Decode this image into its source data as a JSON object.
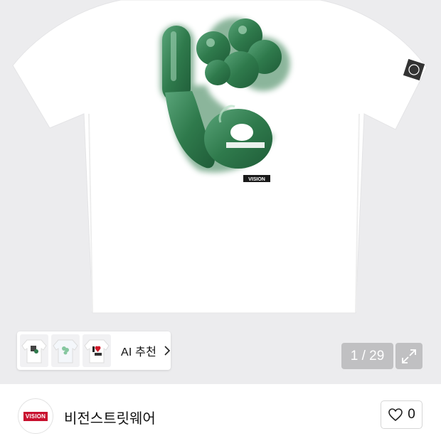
{
  "product_image": {
    "graphic_alt": "white t-shirt with green 'live' clover graphic",
    "logo_tag_text": "VISION"
  },
  "ai_recommend": {
    "label": "AI 추천",
    "thumbnails": [
      "shirt-thumb-1",
      "shirt-thumb-2",
      "shirt-thumb-3"
    ]
  },
  "gallery": {
    "counter": "1 / 29",
    "expand_icon": "expand-arrows-icon"
  },
  "seller": {
    "logo_text": "VISION",
    "name": "비전스트릿웨어",
    "like_count": "0",
    "like_icon": "heart-outline-icon"
  },
  "colors": {
    "graphic_green": "#2f7a4c",
    "brand_red": "#c8102e",
    "image_bg": "#ececee"
  }
}
